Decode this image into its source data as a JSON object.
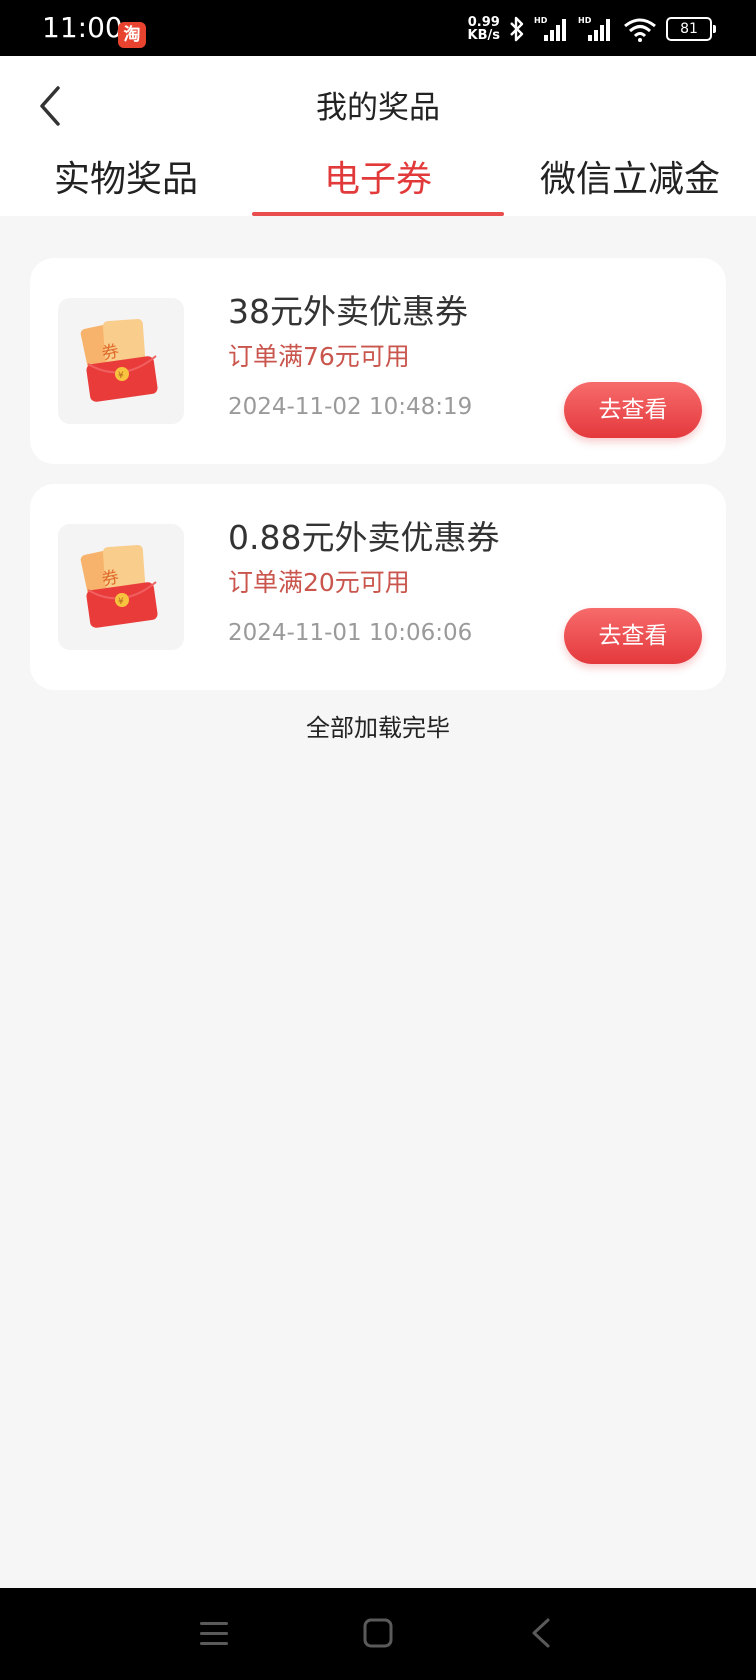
{
  "status_bar": {
    "time": "11:00",
    "app_badge": "淘",
    "net_speed_value": "0.99",
    "net_speed_unit": "KB/s",
    "battery": "81",
    "icons": [
      "taobao-icon",
      "bluetooth-icon",
      "hd-signal-icon",
      "hd-signal-icon",
      "wifi-icon",
      "battery-icon"
    ]
  },
  "header": {
    "title": "我的奖品",
    "back_icon": "chevron-left-icon"
  },
  "tabs": [
    {
      "label": "实物奖品",
      "active": false
    },
    {
      "label": "电子券",
      "active": true
    },
    {
      "label": "微信立减金",
      "active": false
    }
  ],
  "coupons": [
    {
      "title": "38元外卖优惠券",
      "condition": "订单满76元可用",
      "time": "2024-11-02 10:48:19",
      "button": "去查看",
      "icon": "coupon-envelope-icon",
      "icon_text": "券",
      "icon_coin": "¥"
    },
    {
      "title": "0.88元外卖优惠券",
      "condition": "订单满20元可用",
      "time": "2024-11-01 10:06:06",
      "button": "去查看",
      "icon": "coupon-envelope-icon",
      "icon_text": "券",
      "icon_coin": "¥"
    }
  ],
  "footer_text": "全部加载完毕",
  "colors": {
    "accent": "#e23a3a",
    "condition": "#c9554d",
    "button_start": "#f76b6b",
    "button_end": "#e4393d",
    "background": "#f6f6f6"
  },
  "nav_bar": {
    "icons": [
      "menu-icon",
      "home-square-icon",
      "back-triangle-icon"
    ]
  }
}
